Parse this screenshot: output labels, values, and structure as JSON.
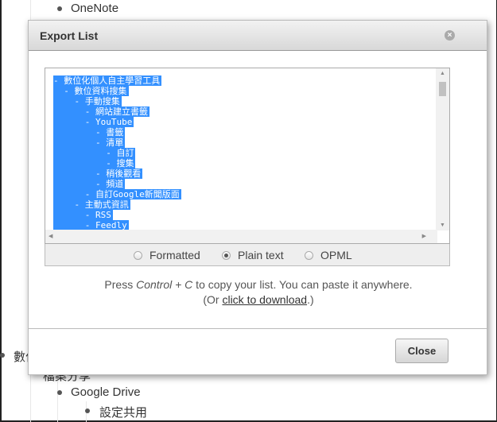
{
  "background": {
    "items": [
      {
        "label": "OneNote"
      },
      {
        "label": "數位"
      },
      {
        "label": "檔案分享"
      },
      {
        "label": "Google Drive"
      },
      {
        "label": "設定共用"
      }
    ]
  },
  "dialog": {
    "title": "Export List",
    "close_icon": "close-circle-icon",
    "export_lines": [
      "- 數位化個人自主學習工具",
      "  - 數位資料搜集",
      "    - 手動搜集",
      "      - 網站建立書籤",
      "      - YouTube",
      "        - 書籤",
      "        - 清單",
      "          - 自訂",
      "          - 搜集",
      "        - 稍後觀看",
      "        - 頻道",
      "      - 自訂Google新聞版面",
      "    - 主動式資訊",
      "      - RSS",
      "      - Feedly"
    ],
    "formats": [
      {
        "label": "Formatted",
        "selected": false
      },
      {
        "label": "Plain text",
        "selected": true
      },
      {
        "label": "OPML",
        "selected": false
      }
    ],
    "message": {
      "press": "Press ",
      "key": "Control + C",
      "rest": " to copy your list. You can paste it anywhere.",
      "or_open": "(Or ",
      "link": "click to download",
      "or_close": ".)"
    },
    "close_button": "Close",
    "selection_color": "#3390ff"
  }
}
